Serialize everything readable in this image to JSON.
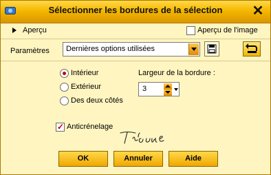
{
  "window": {
    "title": "Sélectionner les bordures de la sélection",
    "close_glyph": "✕"
  },
  "preview": {
    "toggle_label": "Aperçu",
    "image_checkbox_label": "Aperçu de l'image",
    "image_checkbox_checked": false
  },
  "presets": {
    "label": "Paramètres",
    "selected": "Dernières options utilisées"
  },
  "placement": {
    "options": [
      {
        "label": "Intérieur",
        "selected": true
      },
      {
        "label": "Extérieur",
        "selected": false
      },
      {
        "label": "Des deux côtés",
        "selected": false
      }
    ]
  },
  "border_width": {
    "label": "Largeur de la bordure :",
    "value": "3"
  },
  "antialias": {
    "label": "Anticrénelage",
    "checked": true
  },
  "signature_text": "Titoune",
  "buttons": {
    "ok": "OK",
    "cancel": "Annuler",
    "help": "Aide"
  },
  "colors": {
    "titlebar": "#f5b800",
    "background": "#fff5c0",
    "accent_mark": "#b00000"
  },
  "icons": {
    "app": "app-icon",
    "close": "close-icon",
    "play": "play-icon",
    "save_preset": "floppy-disk-icon",
    "reset": "reset-arrow-icon"
  }
}
